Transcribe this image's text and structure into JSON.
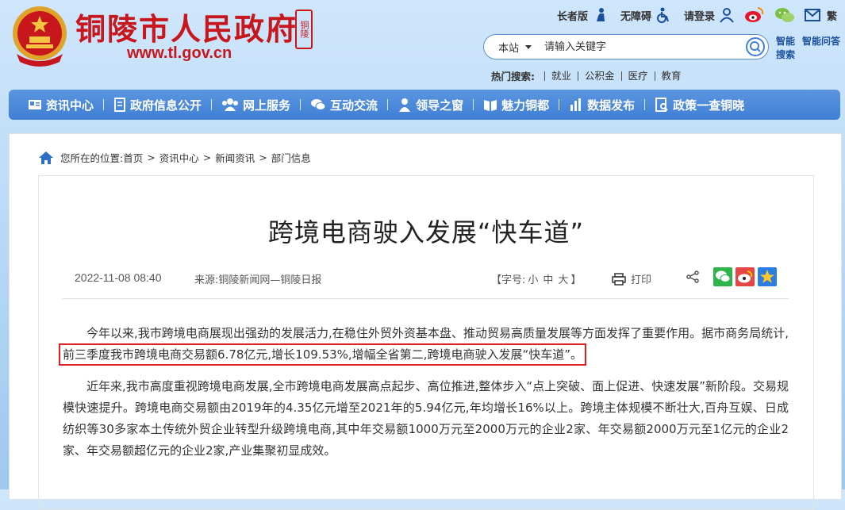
{
  "header": {
    "site_name": "铜陵市人民政府",
    "seal_text": "铜陵",
    "url": "www.tl.gov.cn",
    "elder_version": "长者版",
    "accessible": "无障碍",
    "login": "请登录",
    "lang": "繁",
    "colors": {
      "brand_red": "#c8161d",
      "nav_blue": "#4a87d8"
    }
  },
  "search": {
    "scope": "本站",
    "placeholder": "请输入关键字",
    "smart_search": "智能搜索",
    "smart_qa": "智能问答",
    "hot_label": "热门搜索:",
    "hot_keywords": [
      "就业",
      "公积金",
      "医疗",
      "教育"
    ]
  },
  "nav": {
    "items": [
      {
        "label": "资讯中心",
        "icon": "news-icon"
      },
      {
        "label": "政府信息公开",
        "icon": "document-icon"
      },
      {
        "label": "网上服务",
        "icon": "service-icon"
      },
      {
        "label": "互动交流",
        "icon": "chat-icon"
      },
      {
        "label": "领导之窗",
        "icon": "person-icon"
      },
      {
        "label": "魅力铜都",
        "icon": "book-icon"
      },
      {
        "label": "数据发布",
        "icon": "bar-chart-icon"
      },
      {
        "label": "政策一查铜晓",
        "icon": "policy-search-icon"
      }
    ]
  },
  "breadcrumb": {
    "prefix": "您所在的位置:",
    "items": [
      "首页",
      "资讯中心",
      "新闻资讯",
      "部门信息"
    ]
  },
  "article": {
    "title": "跨境电商驶入发展“快车道”",
    "date": "2022-11-08 08:40",
    "source": "来源:铜陵新闻网—铜陵日报",
    "font_size_label": "【字号:",
    "font_sizes": [
      "小",
      "中",
      "大"
    ],
    "font_size_end": "】",
    "print": "打印",
    "p1_before": "今年以来,我市跨境电商展现出强劲的发展活力,在稳住外贸外资基本盘、推动贸易高质量发展等方面发挥了重要作用。据市商务局统计,",
    "p1_highlight": "前三季度我市跨境电商交易额6.78亿元,增长109.53%,增幅全省第二,跨境电商驶入发展“快车道”。",
    "p2": "近年来,我市高度重视跨境电商发展,全市跨境电商发展高点起步、高位推进,整体步入“点上突破、面上促进、快速发展”新阶段。交易规模快速提升。跨境电商交易额由2019年的4.35亿元增至2021年的5.94亿元,年均增长16%以上。跨境主体规模不断壮大,百舟互娱、日成纺织等30多家本土传统外贸企业转型升级跨境电商,其中年交易额1000万元至2000万元的企业2家、年交易额2000万元至1亿元的企业2家、年交易额超亿元的企业2家,产业集聚初显成效。"
  }
}
